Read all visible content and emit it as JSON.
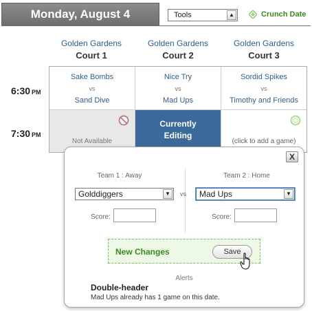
{
  "header": {
    "date": "Monday, August 4",
    "tools_select": "Tools",
    "crunch_label": "Crunch Date"
  },
  "courts": [
    {
      "location": "Golden Gardens",
      "name": "Court 1"
    },
    {
      "location": "Golden Gardens",
      "name": "Court 2"
    },
    {
      "location": "Golden Gardens",
      "name": "Court 3"
    }
  ],
  "times": [
    {
      "time": "6:30",
      "ampm": "PM"
    },
    {
      "time": "7:30",
      "ampm": "PM"
    }
  ],
  "slots": {
    "row1": [
      {
        "team1": "Sake Bombs",
        "vs": "vs",
        "team2": "Sand Dive"
      },
      {
        "team1": "Nice Try",
        "vs": "vs",
        "team2": "Mad Ups"
      },
      {
        "team1": "Sordid Spikes",
        "vs": "vs",
        "team2": "Timothy and Friends"
      }
    ],
    "row2": {
      "not_available": "Not Available",
      "editing_line1": "Currently",
      "editing_line2": "Editing",
      "add_game": "(click to add a game)"
    }
  },
  "popup": {
    "close": "X",
    "team1_label": "Team 1 : Away",
    "team2_label": "Team 2 : Home",
    "team1_value": "Golddiggers",
    "team2_value": "Mad Ups",
    "vs": "vs",
    "score_label": "Score:",
    "changes_label": "New Changes",
    "save_label": "Save",
    "alerts_heading": "Alerts",
    "alert_title": "Double-header",
    "alert_message": "Mad Ups already has 1 game on this date."
  },
  "colors": {
    "link_blue": "#2f5d8a",
    "editing_blue": "#3b6a9a",
    "green": "#3a8a1f"
  },
  "icons": [
    "chevron-down-icon",
    "crunch-diamond-icon",
    "unavailable-icon",
    "add-circle-icon",
    "close-icon",
    "hand-cursor-icon"
  ]
}
